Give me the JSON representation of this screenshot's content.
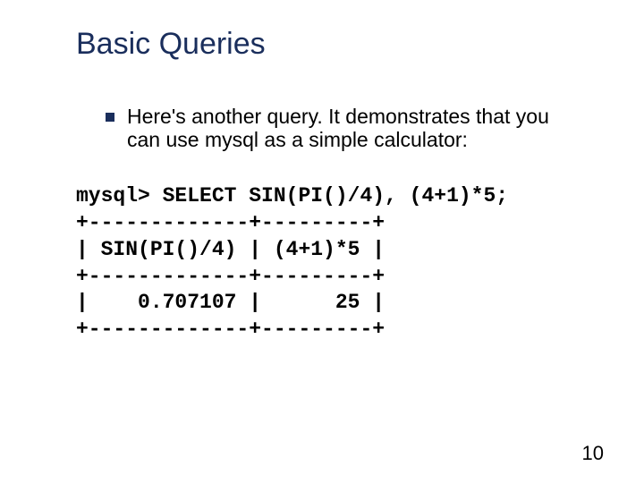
{
  "title": "Basic Queries",
  "bullet_text": "Here's another query. It demonstrates that you can use mysql as a simple calculator:",
  "code": "mysql> SELECT SIN(PI()/4), (4+1)*5;\n+-------------+---------+\n| SIN(PI()/4) | (4+1)*5 |\n+-------------+---------+\n|    0.707107 |      25 |\n+-------------+---------+",
  "page_number": "10"
}
